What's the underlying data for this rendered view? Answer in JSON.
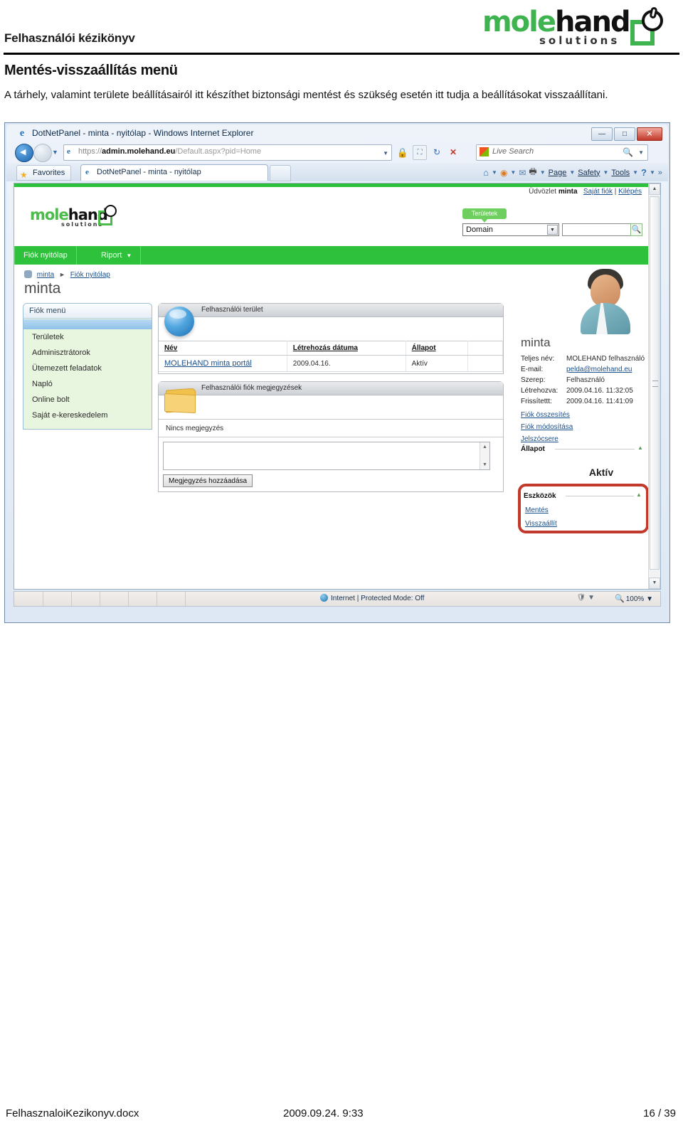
{
  "document": {
    "header_title": "Felhasználói kézikönyv",
    "brand": {
      "part1": "mole",
      "part2": "hand",
      "tagline": "solutions"
    },
    "section_title": "Mentés-visszaállítás menü",
    "intro_paragraph": "A tárhely, valamint területe beállításairól itt készíthet biztonsági mentést és szükség esetén itt tudja a beállításokat visszaállítani.",
    "footer": {
      "filename": "FelhasznaloiKezikonyv.docx",
      "date": "2009.09.24. 9:33",
      "page": "16 / 39"
    }
  },
  "browser": {
    "window_title": "DotNetPanel - minta - nyitólap - Windows Internet Explorer",
    "url_prefix": "https://",
    "url_host": "admin.molehand.eu",
    "url_path": "/Default.aspx?pid=Home",
    "favorites_label": "Favorites",
    "tab_label": "DotNetPanel - minta - nyitólap",
    "search_placeholder": "Live Search",
    "window_buttons": {
      "minimize": "—",
      "maximize": "□",
      "close": "✕"
    },
    "command_bar": [
      {
        "name": "home",
        "label": ""
      },
      {
        "name": "feeds",
        "label": ""
      },
      {
        "name": "mail",
        "label": ""
      },
      {
        "name": "print",
        "label": ""
      },
      {
        "name": "page",
        "label": "Page"
      },
      {
        "name": "safety",
        "label": "Safety"
      },
      {
        "name": "tools",
        "label": "Tools"
      },
      {
        "name": "help",
        "label": ""
      },
      {
        "name": "more",
        "label": "»"
      }
    ],
    "page_menu_label": "Page",
    "safety_menu_label": "Safety",
    "tools_menu_label": "Tools",
    "more_label": "»",
    "status_zone": "Internet | Protected Mode: Off",
    "zoom_level": "100%"
  },
  "webapp": {
    "greeting_prefix": "Üdvözlet",
    "greeting_user": "minta",
    "link_my_account": "Saját fiók",
    "link_logout": "Kilépés",
    "logo": {
      "part1": "mole",
      "part2": "hand",
      "tagline": "solutions"
    },
    "areas_tag": "Területek",
    "scope_select_value": "Domain",
    "search_value": "",
    "nav": [
      {
        "label": "Fiók nyitólap",
        "has_caret": false
      },
      {
        "label": "Riport",
        "has_caret": true
      }
    ],
    "breadcrumb": {
      "user": "minta",
      "current": "Fiók nyitólap"
    },
    "account_title": "minta",
    "left_menu": {
      "header": "Fiók menü",
      "items": [
        "Területek",
        "Adminisztrátorok",
        "Ütemezett feladatok",
        "Napló",
        "Online bolt",
        "Saját e-kereskedelem"
      ]
    },
    "space_panel": {
      "title": "Felhasználói terület",
      "columns": [
        "Név",
        "Létrehozás dátuma",
        "Állapot"
      ],
      "rows": [
        {
          "name": "MOLEHAND minta portál",
          "created": "2009.04.16.",
          "status": "Aktív"
        }
      ]
    },
    "comments_panel": {
      "title": "Felhasználói fiók megjegyzések",
      "empty_text": "Nincs megjegyzés",
      "textarea_value": "",
      "add_button": "Megjegyzés hozzáadása"
    },
    "user_info": {
      "name": "minta",
      "rows": [
        {
          "key": "Teljes név:",
          "value": "MOLEHAND felhasználó",
          "link": false
        },
        {
          "key": "E-mail:",
          "value": "pelda@molehand.eu",
          "link": true
        },
        {
          "key": "Szerep:",
          "value": "Felhasználó",
          "link": false
        },
        {
          "key": "Létrehozva:",
          "value": "2009.04.16. 11:32:05",
          "link": false
        },
        {
          "key": "Frissítettt:",
          "value": "2009.04.16. 11:41:09",
          "link": false
        }
      ],
      "links": [
        "Fiók összesítés",
        "Fiók módosítása",
        "Jelszócsere"
      ]
    },
    "status_section": {
      "header": "Állapot",
      "value": "Aktív"
    },
    "tools_section": {
      "header": "Eszközök",
      "links": [
        "Mentés",
        "Visszaállít"
      ],
      "highlight_color": "#c0392b"
    }
  },
  "colors": {
    "brand_green": "#3fb34f",
    "nav_green": "#2ec13b",
    "link_blue": "#1a4f8a",
    "highlight_red": "#c0392b"
  }
}
